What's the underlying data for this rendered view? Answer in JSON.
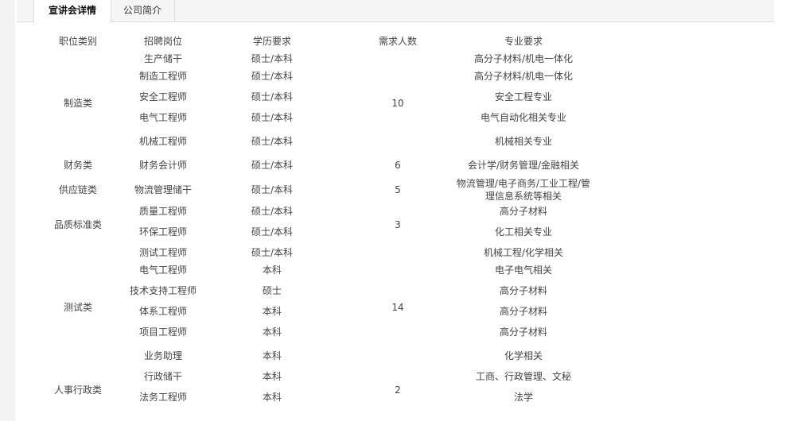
{
  "tabs": [
    {
      "label": "宣讲会详情",
      "active": true
    },
    {
      "label": "公司简介",
      "active": false
    }
  ],
  "table": {
    "headers": {
      "category": "职位类别",
      "position": "招聘岗位",
      "education": "学历要求",
      "count": "需求人数",
      "major": "专业要求"
    },
    "categories": [
      {
        "name": "制造类",
        "count": "10"
      },
      {
        "name": "财务类",
        "count": "6"
      },
      {
        "name": "供应链类",
        "count": "5"
      },
      {
        "name": "品质标准类",
        "count": "3"
      },
      {
        "name": "测试类",
        "count": "14"
      },
      {
        "name": "人事行政类",
        "count": "2"
      }
    ],
    "rows": [
      {
        "position": "生产储干",
        "education": "硕士/本科",
        "major": "高分子材料/机电一体化"
      },
      {
        "position": "制造工程师",
        "education": "硕士/本科",
        "major": "高分子材料/机电一体化"
      },
      {
        "position": "安全工程师",
        "education": "硕士/本科",
        "major": "安全工程专业"
      },
      {
        "position": "电气工程师",
        "education": "硕士/本科",
        "major": "电气自动化相关专业"
      },
      {
        "position": "机械工程师",
        "education": "硕士/本科",
        "major": "机械相关专业"
      },
      {
        "position": "财务会计师",
        "education": "硕士/本科",
        "major": "会计学/财务管理/金融相关"
      },
      {
        "position": "物流管理储干",
        "education": "硕士/本科",
        "major": "物流管理/电子商务/工业工程/管理信息系统等相关"
      },
      {
        "position": "质量工程师",
        "education": "硕士/本科",
        "major": "高分子材料"
      },
      {
        "position": "环保工程师",
        "education": "硕士/本科",
        "major": "化工相关专业"
      },
      {
        "position": "测试工程师",
        "education": "硕士/本科",
        "major": "机械工程/化学相关"
      },
      {
        "position": "电气工程师",
        "education": "本科",
        "major": "电子电气相关"
      },
      {
        "position": "技术支持工程师",
        "education": "硕士",
        "major": "高分子材料"
      },
      {
        "position": "体系工程师",
        "education": "本科",
        "major": "高分子材料"
      },
      {
        "position": "项目工程师",
        "education": "本科",
        "major": "高分子材料"
      },
      {
        "position": "业务助理",
        "education": "本科",
        "major": "化学相关"
      },
      {
        "position": "行政储干",
        "education": "本科",
        "major": "工商、行政管理、文秘"
      },
      {
        "position": "法务工程师",
        "education": "本科",
        "major": "法学"
      }
    ]
  }
}
